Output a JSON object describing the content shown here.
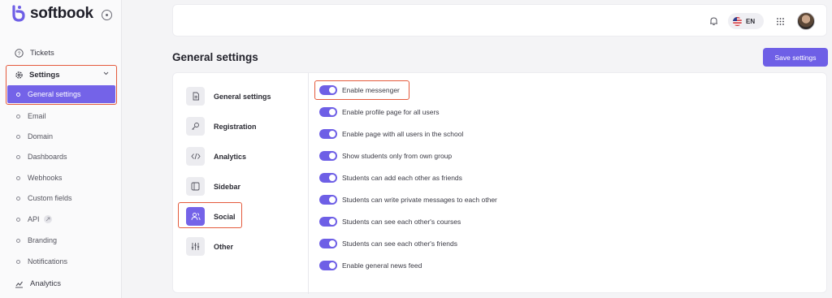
{
  "brand": {
    "name": "softbook",
    "accent": "#7463e8",
    "highlight": "#e45a3c"
  },
  "sidebar": {
    "tickets_label": "Tickets",
    "settings_label": "Settings",
    "active_item": "General settings",
    "sub_items": [
      "Email",
      "Domain",
      "Dashboards",
      "Webhooks",
      "Custom fields",
      "API",
      "Branding",
      "Notifications"
    ],
    "analytics_label": "Analytics"
  },
  "topbar": {
    "language": "EN"
  },
  "page": {
    "title": "General settings",
    "save_label": "Save settings"
  },
  "menu": {
    "items": [
      "General settings",
      "Registration",
      "Analytics",
      "Sidebar",
      "Social",
      "Other"
    ],
    "active": "Social"
  },
  "toggles": [
    {
      "label": "Enable messenger",
      "on": true
    },
    {
      "label": "Enable profile page for all users",
      "on": true
    },
    {
      "label": "Enable page with all users in the school",
      "on": true
    },
    {
      "label": "Show students only from own group",
      "on": true
    },
    {
      "label": "Students can add each other as friends",
      "on": true
    },
    {
      "label": "Students can write private messages to each other",
      "on": true
    },
    {
      "label": "Students can see each other's courses",
      "on": true
    },
    {
      "label": "Students can see each other's friends",
      "on": true
    },
    {
      "label": "Enable general news feed",
      "on": true
    }
  ]
}
